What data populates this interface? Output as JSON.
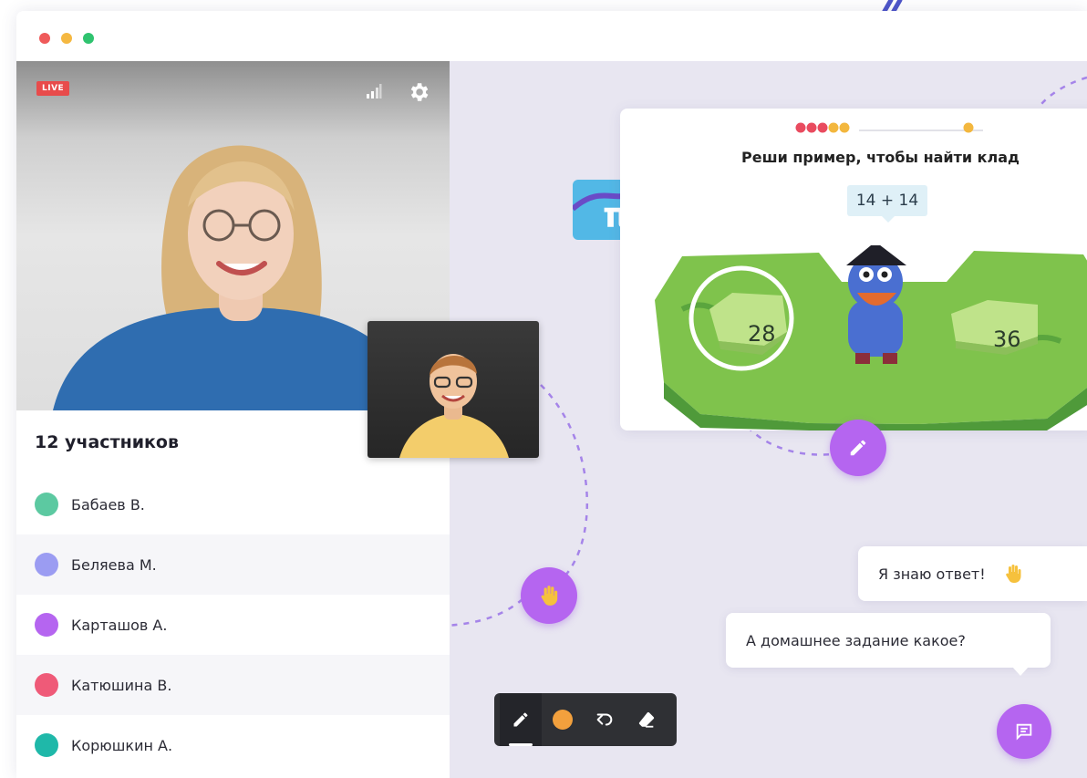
{
  "window": {
    "controls": [
      "close",
      "minimize",
      "maximize"
    ]
  },
  "video": {
    "live_badge": "LIVE"
  },
  "participants": {
    "title": "12 участников",
    "items": [
      {
        "name": "Бабаев В.",
        "color": "#5cc9a1"
      },
      {
        "name": "Беляева М.",
        "color": "#9b9cf2"
      },
      {
        "name": "Карташов А.",
        "color": "#b565f0"
      },
      {
        "name": "Катюшина В.",
        "color": "#ef5a78"
      },
      {
        "name": "Корюшкин А.",
        "color": "#1fb8a9"
      }
    ]
  },
  "game": {
    "task": "Реши пример, чтобы найти клад",
    "expression": "14 + 14",
    "answers": [
      "28",
      "36"
    ],
    "progress_fruits": {
      "collected": 5,
      "total": 6
    }
  },
  "chat": {
    "message_1": "Я знаю ответ!",
    "message_2": "А домашнее задание какое?"
  },
  "toolbar": {
    "tools": [
      "pen-icon",
      "color-swatch",
      "undo-icon",
      "eraser-icon"
    ],
    "color": "#f2a03d"
  },
  "colors": {
    "accent": "#b565f0",
    "live": "#e84b4b",
    "stage": "#e8e6f1"
  }
}
